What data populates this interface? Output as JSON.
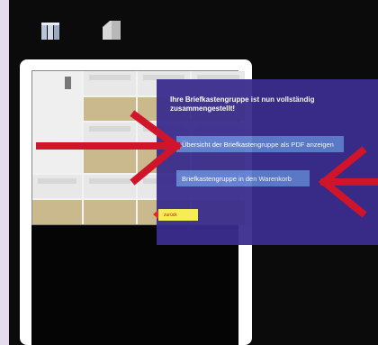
{
  "toolbar": {
    "icons": [
      "mailbox-group-icon",
      "mailbox-single-icon"
    ]
  },
  "dialog": {
    "title": "Ihre Briefkastengruppe ist nun vollständig zusammengestellt!",
    "pdf_button": "Übersicht der Briefkastengruppe als PDF anzeigen",
    "cart_button": "Briefkastengruppe in den Warenkorb"
  },
  "back_button": "zurück",
  "colors": {
    "background": "#e4dcec",
    "dialog": "#3a2d8e",
    "button": "#5e7ed0",
    "arrow": "#d0142a",
    "back_button": "#f6ec55"
  }
}
